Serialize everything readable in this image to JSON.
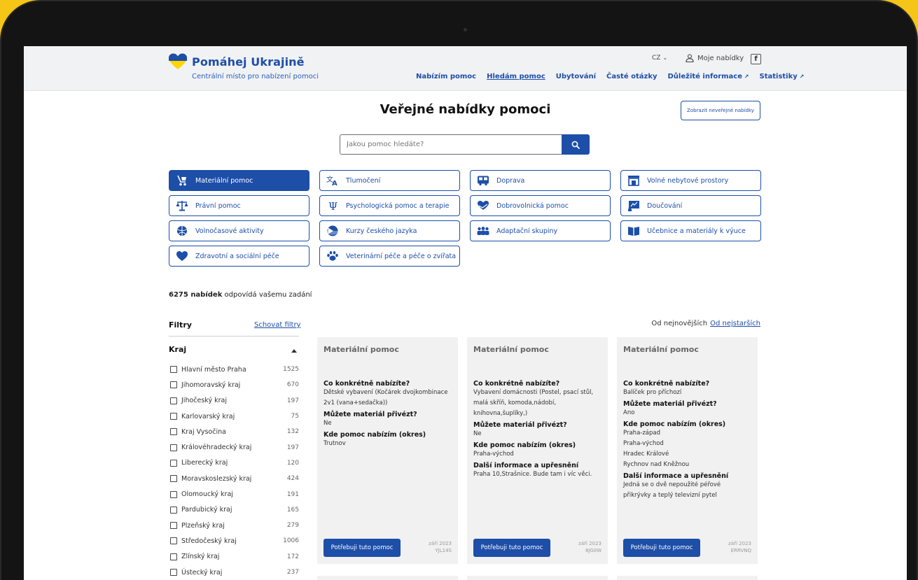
{
  "header": {
    "logo_text": "Pomáhej Ukrajině",
    "tagline": "Centrální místo pro nabízení pomoci",
    "lang": "CZ",
    "my_offers": "Moje nabídky",
    "nav": [
      {
        "label": "Nabízím pomoc"
      },
      {
        "label": "Hledám pomoc"
      },
      {
        "label": "Ubytování"
      },
      {
        "label": "Časté otázky"
      },
      {
        "label": "Důležité informace"
      },
      {
        "label": "Statistiky"
      }
    ]
  },
  "main": {
    "title": "Veřejné nabídky pomoci",
    "private_button": "Zobrazit neveřejné nabídky",
    "search_placeholder": "Jakou pomoc hledáte?",
    "categories": [
      {
        "label": "Materiální pomoc",
        "icon": "stroller-icon"
      },
      {
        "label": "Tlumočení",
        "icon": "translate-icon"
      },
      {
        "label": "Doprava",
        "icon": "bus-icon"
      },
      {
        "label": "Volné nebytové prostory",
        "icon": "building-icon"
      },
      {
        "label": "Právní pomoc",
        "icon": "scales-icon"
      },
      {
        "label": "Psychologická pomoc a terapie",
        "icon": "psi-icon"
      },
      {
        "label": "Dobrovolnická pomoc",
        "icon": "heart-hands-icon"
      },
      {
        "label": "Doučování",
        "icon": "whiteboard-icon"
      },
      {
        "label": "Volnočasové aktivity",
        "icon": "ball-icon"
      },
      {
        "label": "Kurzy českého jazyka",
        "icon": "flag-cz-icon"
      },
      {
        "label": "Adaptační skupiny",
        "icon": "group-icon"
      },
      {
        "label": "Učebnice a materiály k výuce",
        "icon": "book-icon"
      },
      {
        "label": "Zdravotní a sociální péče",
        "icon": "heart-icon"
      },
      {
        "label": "Veterinární péče a péče o zvířata",
        "icon": "paw-icon"
      }
    ],
    "results_count_bold": "6275 nabídek",
    "results_count_rest": " odpovídá vašemu zadání"
  },
  "filters": {
    "title": "Filtry",
    "hide": "Schovat filtry",
    "kraj_title": "Kraj",
    "regions": [
      {
        "name": "Hlavní město Praha",
        "count": "1525"
      },
      {
        "name": "Jihomoravský kraj",
        "count": "670"
      },
      {
        "name": "Jihočeský kraj",
        "count": "197"
      },
      {
        "name": "Karlovarský kraj",
        "count": "75"
      },
      {
        "name": "Kraj Vysočina",
        "count": "132"
      },
      {
        "name": "Královéhradecký kraj",
        "count": "197"
      },
      {
        "name": "Liberecký kraj",
        "count": "120"
      },
      {
        "name": "Moravskoslezský kraj",
        "count": "424"
      },
      {
        "name": "Olomoucký kraj",
        "count": "191"
      },
      {
        "name": "Pardubický kraj",
        "count": "165"
      },
      {
        "name": "Plzeňský kraj",
        "count": "279"
      },
      {
        "name": "Středočeský kraj",
        "count": "1006"
      },
      {
        "name": "Zlínský kraj",
        "count": "172"
      },
      {
        "name": "Ústecký kraj",
        "count": "237"
      }
    ]
  },
  "sort": {
    "newest": "Od nejnovějších",
    "oldest": "Od nejstarších"
  },
  "cards": [
    {
      "category": "Materiální pomoc",
      "fields": [
        {
          "q": "Co konkrétně nabízíte?",
          "a": [
            "Dětské vybavení (Kočárek dvojkombinace",
            "2v1 (vana+sedačka))"
          ]
        },
        {
          "q": "Můžete materiál přivézt?",
          "a": [
            "Ne"
          ]
        },
        {
          "q": "Kde pomoc nabízím (okres)",
          "a": [
            "Trutnov"
          ]
        }
      ],
      "button": "Potřebuji tuto pomoc",
      "date": "září 2023",
      "code": "YJL14S"
    },
    {
      "category": "Materiální pomoc",
      "fields": [
        {
          "q": "Co konkrétně nabízíte?",
          "a": [
            "Vybavení domácnosti (Postel, psací stůl,",
            "malá skříň, komoda,nádobí,",
            "knihovna,šuplíky,)"
          ]
        },
        {
          "q": "Můžete materiál přivézt?",
          "a": [
            "Ne"
          ]
        },
        {
          "q": "Kde pomoc nabízím (okres)",
          "a": [
            "Praha-východ"
          ]
        },
        {
          "q": "Další informace a upřesnění",
          "a": [
            "Praha 10,Strašnice. Bude tam i víc věci."
          ]
        }
      ],
      "button": "Potřebuji tuto pomoc",
      "date": "září 2023",
      "code": "8JGIIW"
    },
    {
      "category": "Materiální pomoc",
      "fields": [
        {
          "q": "Co konkrétně nabízíte?",
          "a": [
            "Balíček pro příchozí"
          ]
        },
        {
          "q": "Můžete materiál přivézt?",
          "a": [
            "Ano"
          ]
        },
        {
          "q": "Kde pomoc nabízím (okres)",
          "a": [
            "Praha-západ",
            "Praha-východ",
            "Hradec Králové",
            "Rychnov nad Kněžnou"
          ]
        },
        {
          "q": "Další informace a upřesnění",
          "a": [
            "Jedná se o dvě nepoužité péřové",
            "přikrývky a teplý televizní pytel"
          ]
        }
      ],
      "button": "Potřebuji tuto pomoc",
      "date": "září 2023",
      "code": "ERRVNQ"
    }
  ],
  "colors": {
    "brand": "#1d4ea8",
    "background": "#f5c518"
  }
}
